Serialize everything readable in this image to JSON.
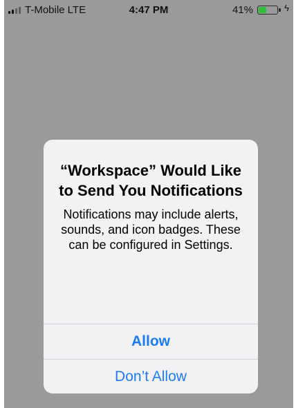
{
  "status_bar": {
    "carrier": "T-Mobile  LTE",
    "time": "4:47 PM",
    "battery_percent_label": "41%",
    "battery_level": 0.41,
    "battery_color": "#2fbf3a",
    "signal_bars_filled": 2,
    "signal_bars_total": 4,
    "charging_icon": "lightning-bolt-icon"
  },
  "alert": {
    "title": "“Workspace” Would Like to Send You Notifications",
    "message": "Notifications may include alerts, sounds, and icon badges. These can be configured in Settings.",
    "allow_label": "Allow",
    "dont_allow_label": "Don’t Allow",
    "button_color": "#1a7cf5"
  }
}
